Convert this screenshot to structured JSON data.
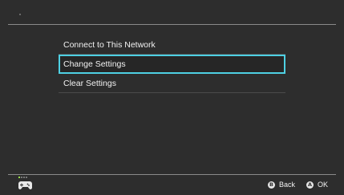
{
  "menu": {
    "items": [
      {
        "label": "Connect to This Network",
        "selected": false
      },
      {
        "label": "Change Settings",
        "selected": true
      },
      {
        "label": "Clear Settings",
        "selected": false
      }
    ]
  },
  "footer": {
    "controller_icon": "controller-icon",
    "back": {
      "glyph": "B",
      "label": "Back"
    },
    "ok": {
      "glyph": "A",
      "label": "OK"
    }
  },
  "colors": {
    "background": "#2d2d2d",
    "selection": "#4ed0e3",
    "controller_indicator": "#9ce24a"
  }
}
